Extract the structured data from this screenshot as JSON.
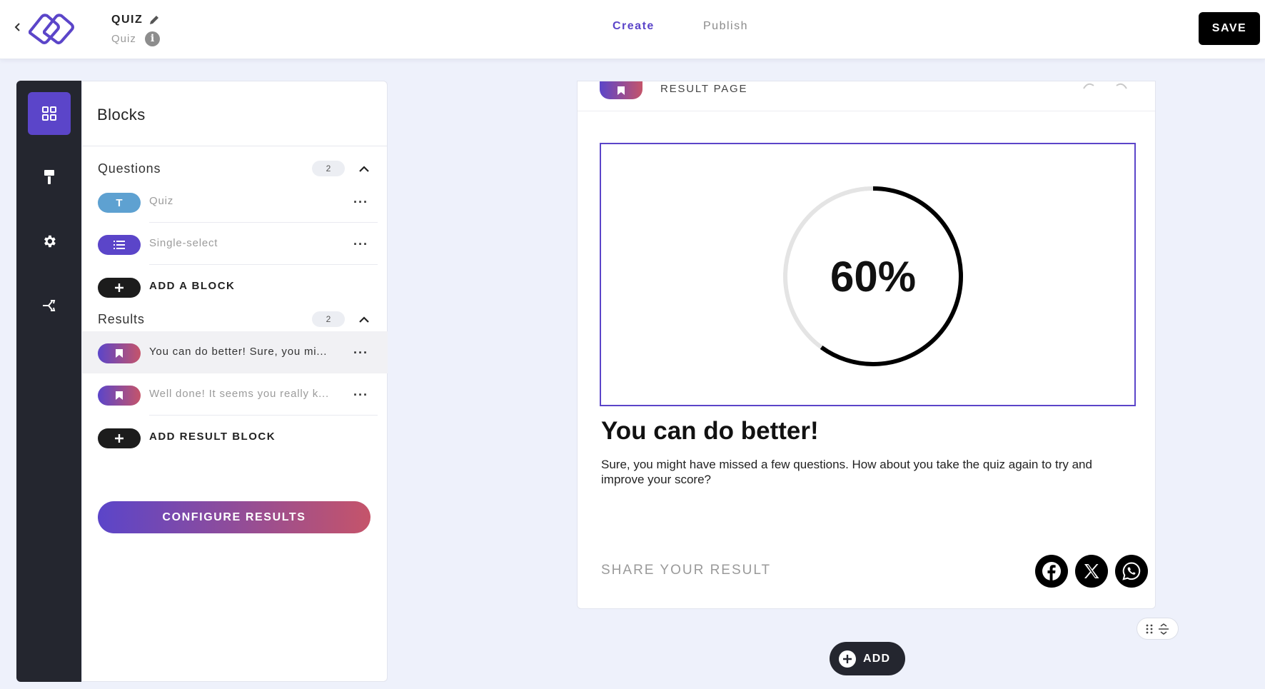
{
  "header": {
    "title": "QUIZ",
    "subtitle": "Quiz",
    "tabs": [
      {
        "label": "Create",
        "active": true
      },
      {
        "label": "Publish",
        "active": false
      }
    ],
    "save_label": "SAVE"
  },
  "rail": {
    "items": [
      {
        "icon": "blocks-grid-icon",
        "active": true
      },
      {
        "icon": "paint-roller-icon",
        "active": false
      },
      {
        "icon": "gear-icon",
        "active": false
      },
      {
        "icon": "share-branch-icon",
        "active": false
      }
    ]
  },
  "blocks_panel": {
    "title": "Blocks",
    "questions": {
      "label": "Questions",
      "count": "2",
      "items": [
        {
          "type": "text",
          "label": "Quiz"
        },
        {
          "type": "single-select",
          "label": "Single-select"
        }
      ],
      "add_label": "ADD A BLOCK"
    },
    "results": {
      "label": "Results",
      "count": "2",
      "items": [
        {
          "label": "You can do better! Sure, you mi...",
          "selected": true
        },
        {
          "label": "Well done! It seems you really k...",
          "selected": false
        }
      ],
      "add_label": "ADD RESULT BLOCK"
    },
    "configure_label": "CONFIGURE RESULTS"
  },
  "canvas": {
    "page_label": "RESULT PAGE",
    "score_text": "60%",
    "score_fraction": 0.6,
    "result_title": "You can do better!",
    "result_body": "Sure, you might have missed a few questions. How about you take the quiz again to try and improve your score?",
    "share_label": "SHARE YOUR RESULT",
    "share_icons": [
      "facebook-icon",
      "x-twitter-icon",
      "whatsapp-icon"
    ],
    "add_label": "ADD"
  },
  "colors": {
    "accent": "#5b45c9",
    "gradient_end": "#c5546a",
    "rail_bg": "#24262f",
    "text_pill": "#5ea1d1"
  }
}
